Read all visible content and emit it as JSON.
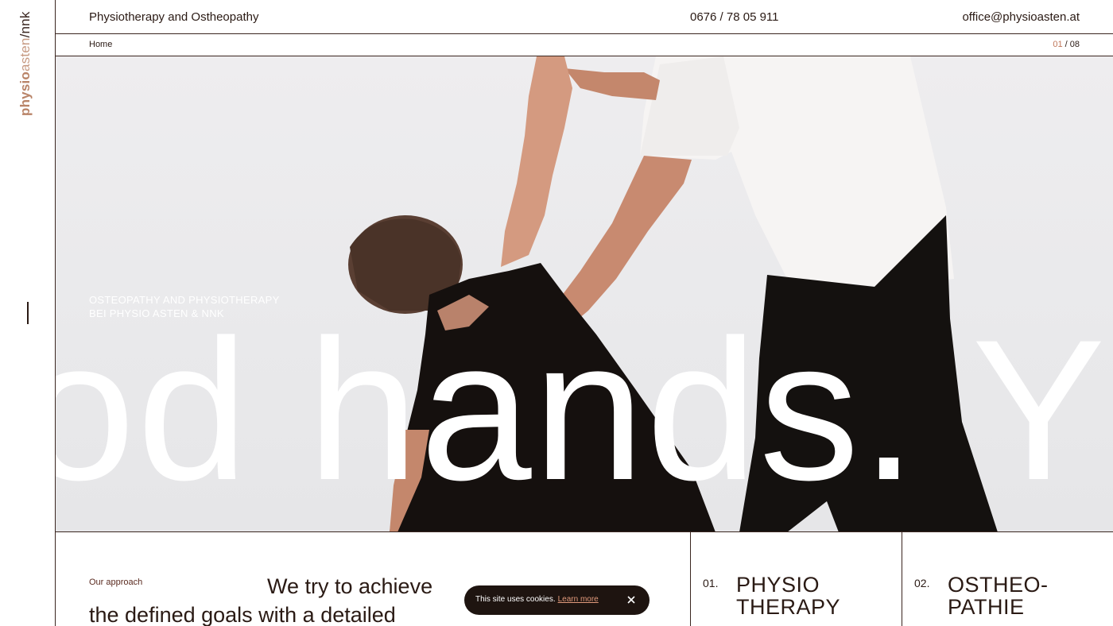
{
  "sidebar": {
    "logo": {
      "part1": "physio",
      "part2": "asten",
      "sep": "/",
      "part3": "nnk"
    }
  },
  "header": {
    "brand": "Physiotherapy and Ostheopathy",
    "phone": "0676 / 78 05 911",
    "email": "office@physioasten.at"
  },
  "subnav": {
    "breadcrumb": "Home",
    "slide_current": "01",
    "slide_sep": " / ",
    "slide_total": "08"
  },
  "hero": {
    "tagline_line1": "OSTEOPATHY AND PHYSIOTHERAPY",
    "tagline_line2": "BEI PHYSIO ASTEN & NNK",
    "big_text": "od hands. Y"
  },
  "approach": {
    "label": "Our approach",
    "text_line1": "We try to achieve",
    "text_line2": "the defined goals with a detailed"
  },
  "services": [
    {
      "number": "01.",
      "title_line1": "PHYSIO",
      "title_line2": "THERAPY"
    },
    {
      "number": "02.",
      "title_line1": "OSTHEO-",
      "title_line2": "PATHIE"
    }
  ],
  "cookie": {
    "message": "This site uses cookies.",
    "link": "Learn more",
    "close_icon": "close-icon"
  },
  "colors": {
    "accent": "#c0775a",
    "dark": "#2a1a14",
    "hero_bg": "#ebebed"
  }
}
